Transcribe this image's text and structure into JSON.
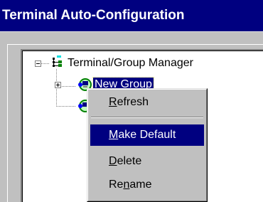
{
  "window": {
    "title": "Terminal Auto-Configuration"
  },
  "tree": {
    "root": {
      "label": "Terminal/Group Manager",
      "icon": "terminal-group-manager-icon",
      "expanded": true
    },
    "children": [
      {
        "label": "New Group",
        "icon": "group-icon",
        "selected": true,
        "expander": "plus"
      },
      {
        "label": "",
        "icon": "group-icon"
      }
    ]
  },
  "context_menu": {
    "items": [
      {
        "accel": "R",
        "rest": "efresh",
        "active": false
      },
      {
        "separator": true
      },
      {
        "accel": "M",
        "rest": "ake Default",
        "active": true
      },
      {
        "accel": "D",
        "rest": "elete",
        "active": false
      },
      {
        "pre": "Re",
        "accel": "n",
        "rest": "ame",
        "active": false
      }
    ]
  },
  "colors": {
    "title_bar": "#000080",
    "face": "#c0c0c0",
    "highlight": "#000080",
    "panel": "#ffffff"
  }
}
